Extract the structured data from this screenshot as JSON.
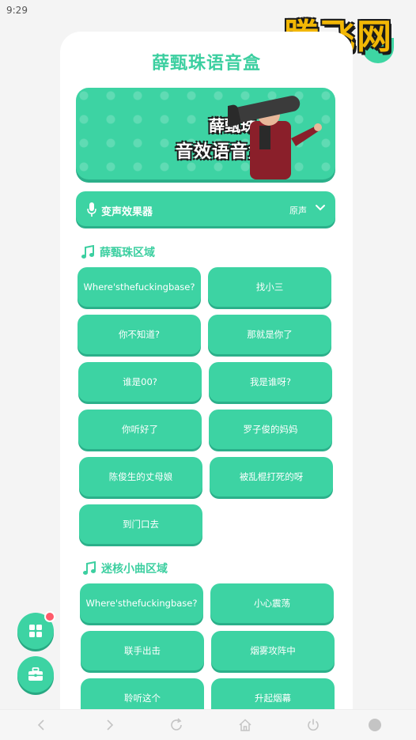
{
  "status": {
    "time": "9:29"
  },
  "watermark": {
    "text": "腾飞网"
  },
  "app": {
    "title": "薛甄珠语音盒"
  },
  "banner": {
    "line1": "薛甄珠",
    "line2": "音效语音盒子"
  },
  "voice_effect": {
    "label": "变声效果器",
    "value": "原声"
  },
  "sections": [
    {
      "title": "薛甄珠区域",
      "buttons": [
        "Where'sthefuckingbase?",
        "找小三",
        "你不知道?",
        "那就是你了",
        "谁是00?",
        "我是谁呀?",
        "你听好了",
        "罗子俊的妈妈",
        "陈俊生的丈母娘",
        "被乱棍打死的呀",
        "到门口去"
      ]
    },
    {
      "title": "迷核小曲区域",
      "buttons": [
        "Where'sthefuckingbase?",
        "小心震荡",
        "联手出击",
        "烟雾攻阵中",
        "聆听这个",
        "升起烟幕"
      ]
    }
  ],
  "colors": {
    "accent": "#3dd3a3",
    "accent_dark": "#2bb08a",
    "title": "#3ccfa0",
    "badge": "#ff5b6b"
  },
  "icons": {
    "mic": "mic-icon",
    "chevron": "chevron-down-icon",
    "note": "music-note-icon",
    "grid": "grid-icon",
    "toolbox": "toolbox-icon"
  }
}
